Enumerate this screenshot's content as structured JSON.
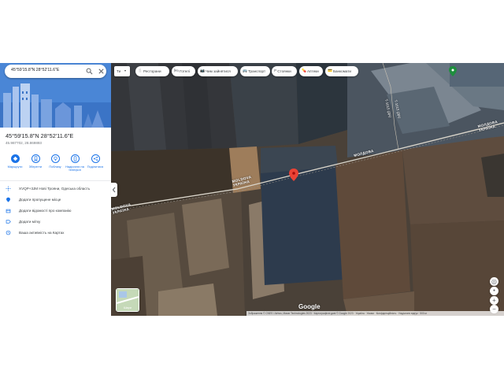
{
  "search": {
    "value": "45°59'15.8\"N 28°52'11.6\"E"
  },
  "place": {
    "title": "45°59'15.8\"N 28°52'11.6\"E",
    "decimal": "45.987702, 28.869893"
  },
  "actions": [
    {
      "label": "Маршрути",
      "icon": "directions-icon"
    },
    {
      "label": "Зберегти",
      "icon": "bookmark-icon"
    },
    {
      "label": "Поблизу",
      "icon": "nearby-icon"
    },
    {
      "label": "Надіслати на телефон",
      "icon": "send-to-phone-icon"
    },
    {
      "label": "Поділитися",
      "icon": "share-icon"
    }
  ],
  "details": [
    {
      "text": "XVQP+3JM Нові Трояни, Одеська область",
      "icon": "plus-code-icon"
    },
    {
      "text": "Додати пропущене місце",
      "icon": "add-place-icon"
    },
    {
      "text": "Додати відомості про компанію",
      "icon": "add-business-icon"
    },
    {
      "text": "Додати мітку",
      "icon": "label-icon"
    },
    {
      "text": "Ваша активність на Картах",
      "icon": "history-icon"
    }
  ],
  "map": {
    "language_chip": "Ти",
    "chips": [
      {
        "label": "Ресторани",
        "icon": "🍴"
      },
      {
        "label": "Готелі",
        "icon": "🛏"
      },
      {
        "label": "Чим зайнятися",
        "icon": "📷"
      },
      {
        "label": "Транспорт",
        "icon": "🚌"
      },
      {
        "label": "Стоянки",
        "icon": "P"
      },
      {
        "label": "Аптеки",
        "icon": "💊"
      },
      {
        "label": "Банкомати",
        "icon": "💳"
      }
    ],
    "labels": {
      "border_moldova_left": "MOLDOVA",
      "border_ukraine_left": "УКРАЇНА",
      "border_moldova_mid": "MOLDOVA",
      "border_ukraine_mid": "УКРАЇНА",
      "border_moldova_center": "МОЛДОВА",
      "border_moldova_right": "МОЛДОВА",
      "border_ukraine_right": "УКРАЇНА",
      "road_label": "Т-1615 (ДА)",
      "road_label_2": "Т-1615 (ДА)"
    },
    "google": "Google",
    "attribution": "Зображення © CNES / Airbus, Maxar Technologies 2023 · Картографічні дані © Google 2023 · Україна · Умови · Конфіденційність · Надіслати відгук · 500 м",
    "layers_label": "Шари",
    "colors": {
      "pin": "#ea4335",
      "accent": "#1a73e8"
    }
  }
}
